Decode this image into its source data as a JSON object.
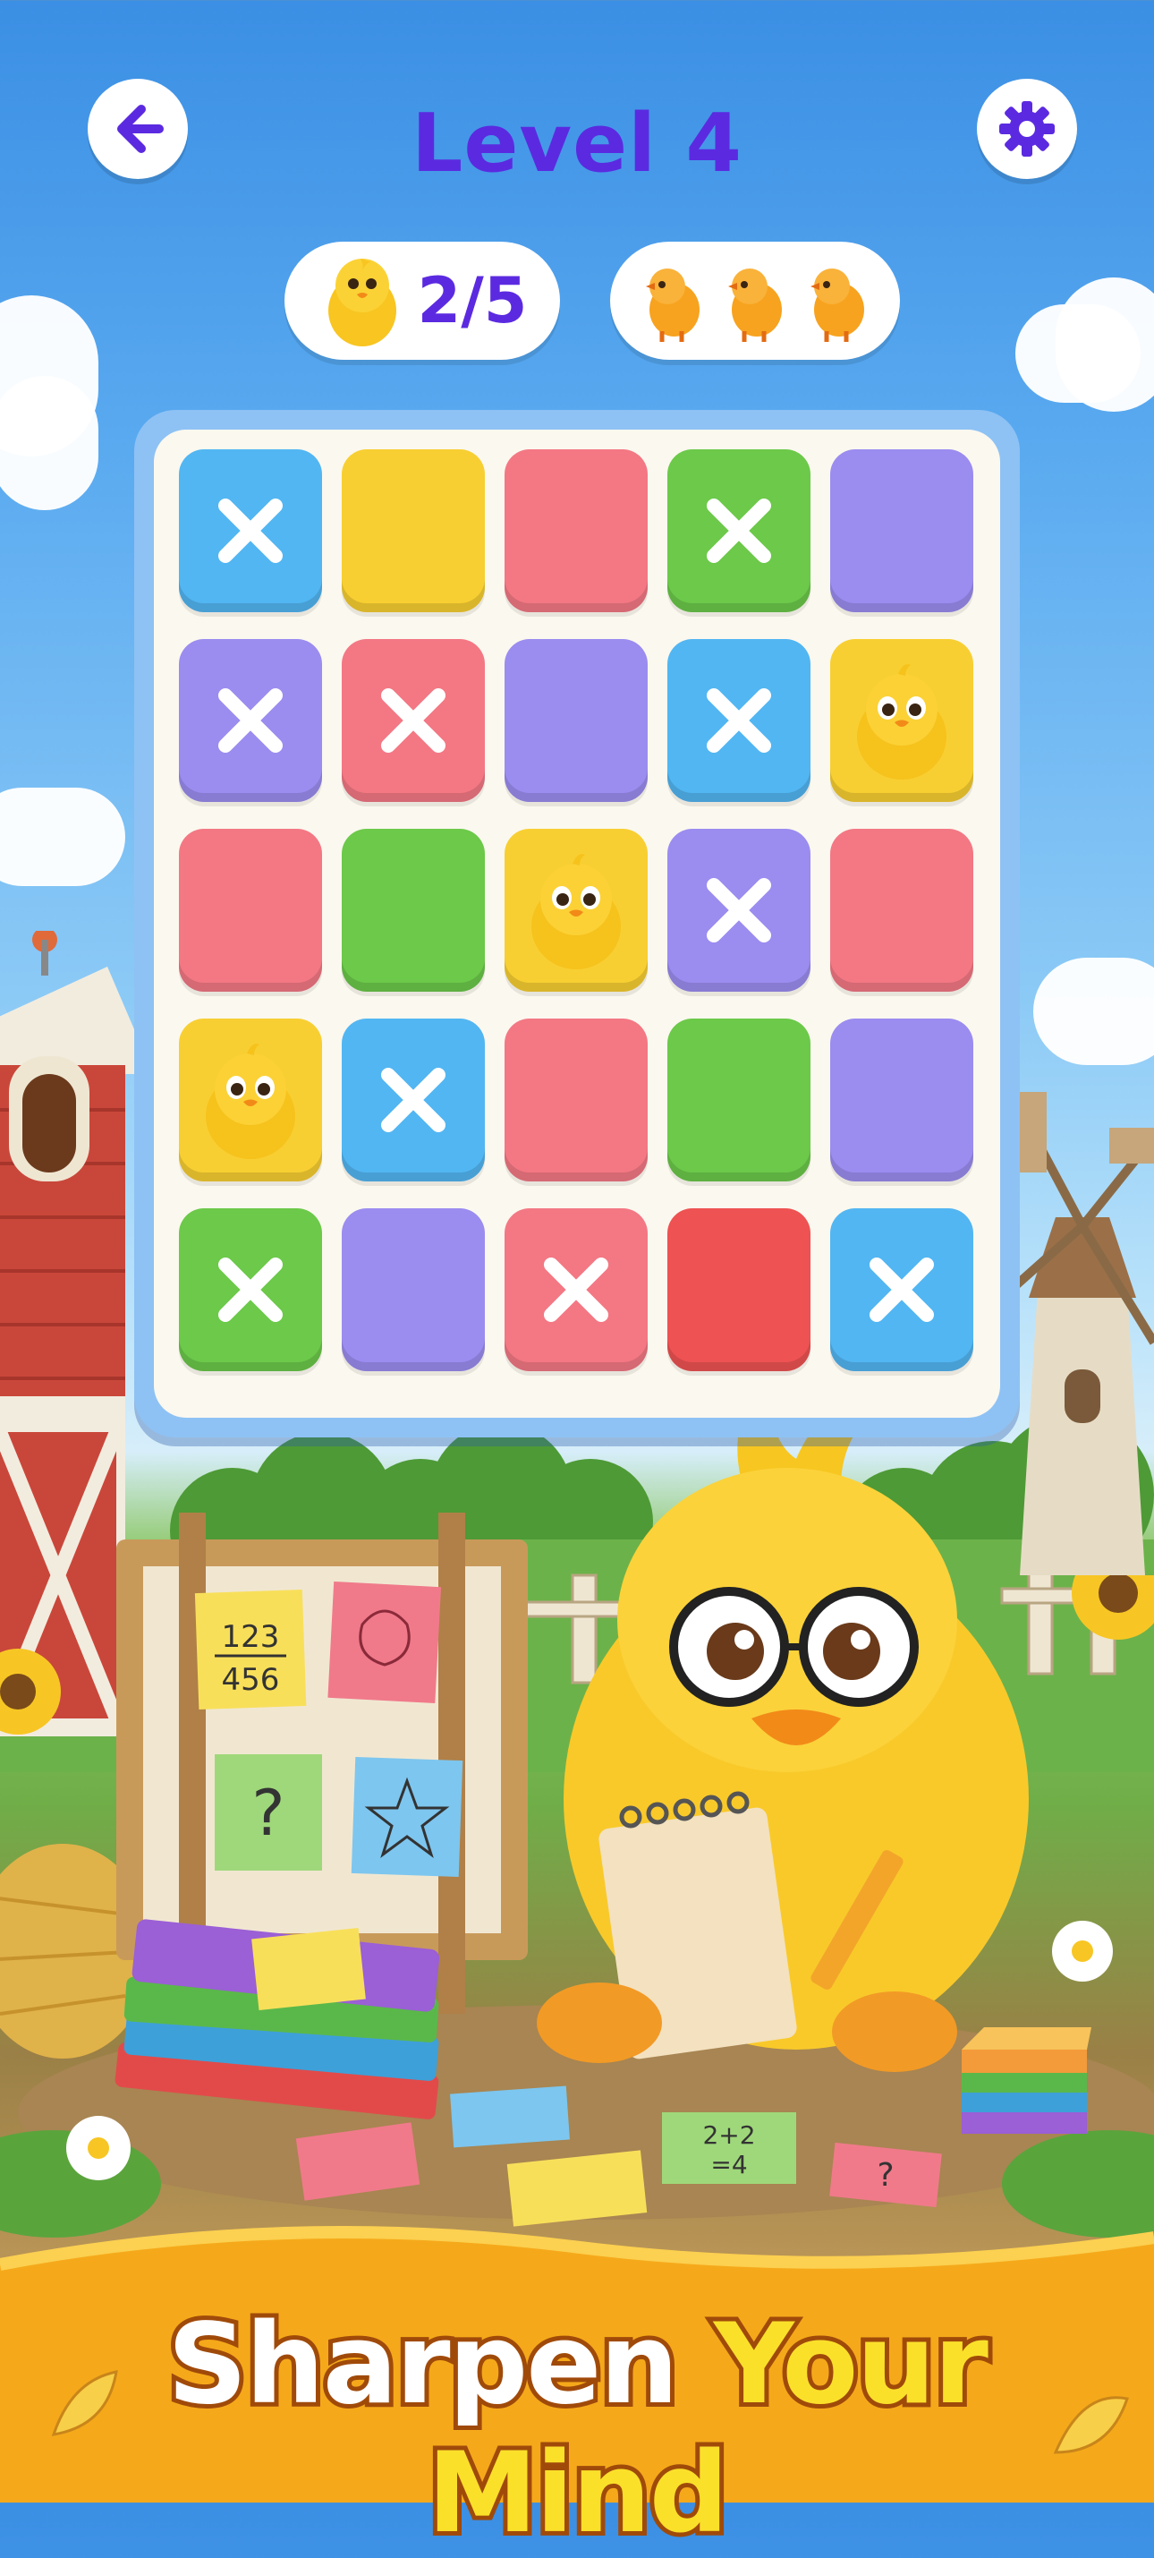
{
  "header": {
    "back_icon": "arrow-left-icon",
    "title": "Level 4",
    "settings_icon": "gear-icon"
  },
  "status": {
    "found_label": "2/5",
    "found_icon": "chick-icon",
    "lives_icons": [
      "chick-icon",
      "chick-icon",
      "chick-icon"
    ]
  },
  "board": {
    "rows": [
      [
        {
          "color": "blue",
          "state": "crossed"
        },
        {
          "color": "yellow",
          "state": "empty"
        },
        {
          "color": "red",
          "state": "empty"
        },
        {
          "color": "green",
          "state": "crossed"
        },
        {
          "color": "purple",
          "state": "empty"
        }
      ],
      [
        {
          "color": "purple",
          "state": "crossed"
        },
        {
          "color": "red",
          "state": "crossed"
        },
        {
          "color": "purple",
          "state": "empty"
        },
        {
          "color": "blue",
          "state": "crossed"
        },
        {
          "color": "yellow",
          "state": "chick"
        }
      ],
      [
        {
          "color": "red",
          "state": "empty"
        },
        {
          "color": "green",
          "state": "empty"
        },
        {
          "color": "yellow",
          "state": "chick"
        },
        {
          "color": "purple",
          "state": "crossed"
        },
        {
          "color": "red",
          "state": "empty"
        }
      ],
      [
        {
          "color": "yellow",
          "state": "chick"
        },
        {
          "color": "blue",
          "state": "crossed"
        },
        {
          "color": "red",
          "state": "empty"
        },
        {
          "color": "green",
          "state": "empty"
        },
        {
          "color": "purple",
          "state": "empty"
        }
      ],
      [
        {
          "color": "green",
          "state": "crossed"
        },
        {
          "color": "purple",
          "state": "empty"
        },
        {
          "color": "red",
          "state": "crossed"
        },
        {
          "color": "darkred",
          "state": "empty"
        },
        {
          "color": "blue",
          "state": "crossed"
        }
      ]
    ]
  },
  "scene": {
    "notes": [
      "123\n456",
      "?",
      "2+2\n=4"
    ],
    "characters": [
      "chick-with-glasses",
      "barn",
      "windmill",
      "easel",
      "books",
      "hay-bale",
      "flowers"
    ]
  },
  "banner": {
    "word1": "Sharpen",
    "word2": "Your Mind"
  },
  "colors": {
    "accent": "#5b2ae0",
    "blue": "#52b6f2",
    "yellow": "#f8cf32",
    "red": "#f37884",
    "green": "#6cc94a",
    "purple": "#9b8cf0",
    "darkred": "#ee5252",
    "banner_orange": "#f5a91a"
  }
}
